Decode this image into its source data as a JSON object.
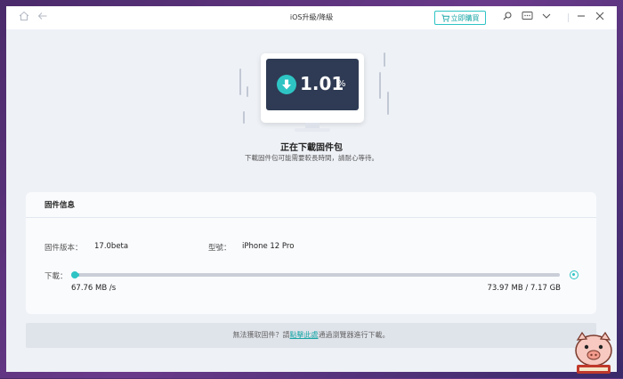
{
  "window": {
    "title": "iOS升級/降級",
    "buy_label": "立即購買"
  },
  "illustration": {
    "progress_value": "1.01",
    "progress_unit": "%"
  },
  "status": {
    "headline": "正在下載固件包",
    "subline": "下載固件包可能需要較長時間，請耐心等待。"
  },
  "firmware": {
    "section_title": "固件信息",
    "version_label": "固件版本：",
    "version_value": "17.0beta",
    "model_label": "型號：",
    "model_value": "iPhone 12 Pro",
    "download_label": "下載：",
    "speed": "67.76 MB /s",
    "size_progress": "73.97 MB / 7.17 GB",
    "progress_fraction": 0.0101
  },
  "footer": {
    "prefix": "無法獲取固件？請",
    "link": "點擊此處",
    "suffix": "通過瀏覽器進行下載。"
  },
  "colors": {
    "accent": "#2ec4c4",
    "screen": "#2f3b54"
  },
  "icons": [
    "home-icon",
    "back-icon",
    "cart-icon",
    "search-icon",
    "feedback-icon",
    "chevron-down-icon",
    "minimize-icon",
    "close-icon",
    "download-arrow-icon"
  ]
}
